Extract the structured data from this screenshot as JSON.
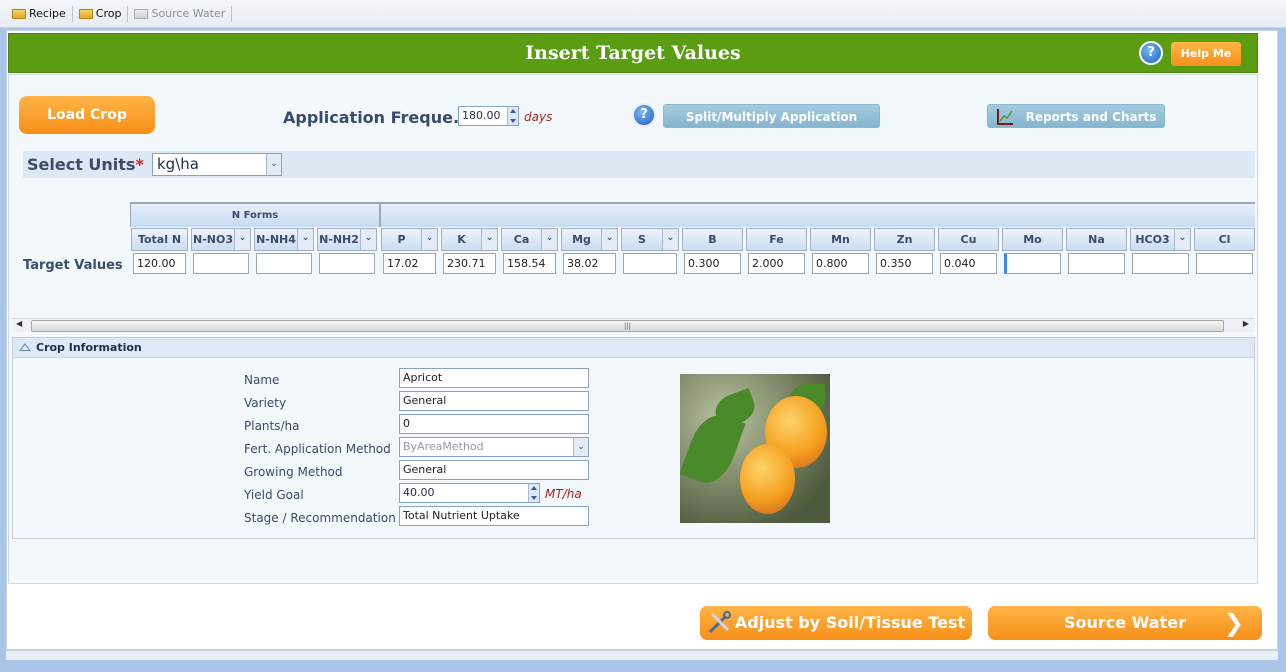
{
  "tabs": [
    {
      "label": "Recipe",
      "enabled": true
    },
    {
      "label": "Crop",
      "enabled": true
    },
    {
      "label": "Source Water",
      "enabled": false
    }
  ],
  "header": {
    "title": "Insert Target Values",
    "help_label": "Help Me"
  },
  "toolbar": {
    "load_crop": "Load Crop",
    "app_freq_label": "Application Freque...",
    "app_freq_value": "180.00",
    "app_freq_unit": "days",
    "split_label": "Split/Multiply Application",
    "reports_label": "Reports and Charts"
  },
  "units": {
    "label": "Select Units",
    "required": "*",
    "value": "kg\\ha"
  },
  "grid": {
    "group_label": "N Forms",
    "row_label": "Target Values",
    "columns": [
      {
        "name": "Total N",
        "dropdown": false,
        "value": "120.00"
      },
      {
        "name": "N-NO3",
        "dropdown": true,
        "value": ""
      },
      {
        "name": "N-NH4",
        "dropdown": true,
        "value": ""
      },
      {
        "name": "N-NH2",
        "dropdown": true,
        "value": ""
      },
      {
        "name": "P",
        "dropdown": true,
        "value": "17.02"
      },
      {
        "name": "K",
        "dropdown": true,
        "value": "230.71"
      },
      {
        "name": "Ca",
        "dropdown": true,
        "value": "158.54"
      },
      {
        "name": "Mg",
        "dropdown": true,
        "value": "38.02"
      },
      {
        "name": "S",
        "dropdown": true,
        "value": ""
      },
      {
        "name": "B",
        "dropdown": false,
        "value": "0.300"
      },
      {
        "name": "Fe",
        "dropdown": false,
        "value": "2.000"
      },
      {
        "name": "Mn",
        "dropdown": false,
        "value": "0.800"
      },
      {
        "name": "Zn",
        "dropdown": false,
        "value": "0.350"
      },
      {
        "name": "Cu",
        "dropdown": false,
        "value": "0.040"
      },
      {
        "name": "Mo",
        "dropdown": false,
        "value": ""
      },
      {
        "name": "Na",
        "dropdown": false,
        "value": ""
      },
      {
        "name": "HCO3",
        "dropdown": true,
        "value": ""
      },
      {
        "name": "Cl",
        "dropdown": false,
        "value": ""
      }
    ]
  },
  "crop_info": {
    "title": "Crop Information",
    "fields": [
      {
        "label": "Name",
        "value": "Apricot"
      },
      {
        "label": "Variety",
        "value": "General"
      },
      {
        "label": "Plants/ha",
        "value": "0"
      },
      {
        "label": "Fert. Application Method",
        "value": "ByAreaMethod"
      },
      {
        "label": "Growing Method",
        "value": "General"
      },
      {
        "label": "Yield Goal",
        "value": "40.00",
        "unit": "MT/ha"
      },
      {
        "label": "Stage / Recommendation",
        "value": "Total Nutrient Uptake"
      }
    ]
  },
  "footer": {
    "adjust_label": "Adjust by Soil/Tissue Test",
    "next_label": "Source Water"
  }
}
